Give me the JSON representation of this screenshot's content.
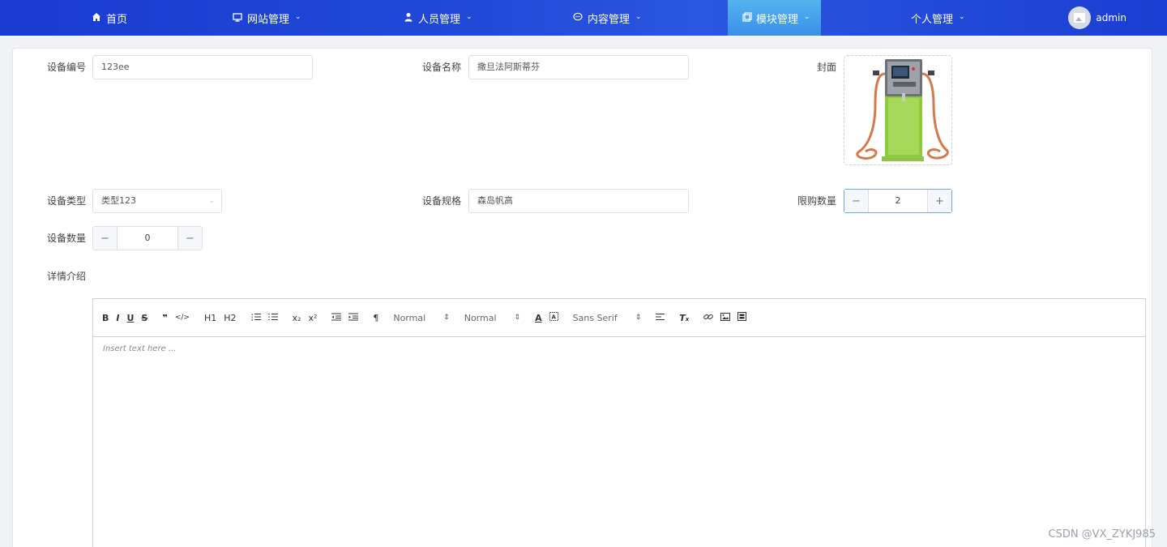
{
  "nav": {
    "items": [
      {
        "label": "首页",
        "icon": "home-icon",
        "has_dropdown": false
      },
      {
        "label": "网站管理",
        "icon": "monitor-icon",
        "has_dropdown": true
      },
      {
        "label": "人员管理",
        "icon": "user-icon",
        "has_dropdown": true
      },
      {
        "label": "内容管理",
        "icon": "chat-icon",
        "has_dropdown": true
      },
      {
        "label": "模块管理",
        "icon": "copy-icon",
        "has_dropdown": true,
        "active": true
      },
      {
        "label": "个人管理",
        "icon": "",
        "has_dropdown": true
      }
    ],
    "user": "admin"
  },
  "form": {
    "device_code_label": "设备编号",
    "device_code_value": "123ee",
    "device_name_label": "设备名称",
    "device_name_value": "撒旦法阿斯蒂芬",
    "cover_label": "封面",
    "device_type_label": "设备类型",
    "device_type_value": "类型123",
    "device_spec_label": "设备规格",
    "device_spec_value": "森岛帆高",
    "limit_label": "限购数量",
    "limit_value": "2",
    "quantity_label": "设备数量",
    "quantity_value": "0",
    "detail_label": "详情介绍"
  },
  "editor": {
    "toolbar": [
      "B",
      "I",
      "U",
      "S",
      "❞",
      "</>",
      "H1",
      "H2",
      "list-ordered",
      "list-bullet",
      "x₂",
      "x²",
      "outdent",
      "indent",
      "¶"
    ],
    "header_picker": "Normal",
    "size_picker": "Normal",
    "font_picker": "Sans Serif",
    "placeholder": "Insert text here ..."
  },
  "watermark": "CSDN @VX_ZYKJ985",
  "colors": {
    "nav_bg": "#1f45d6",
    "nav_active": "#4aa6ee",
    "focus_border": "#6ea7f5"
  }
}
